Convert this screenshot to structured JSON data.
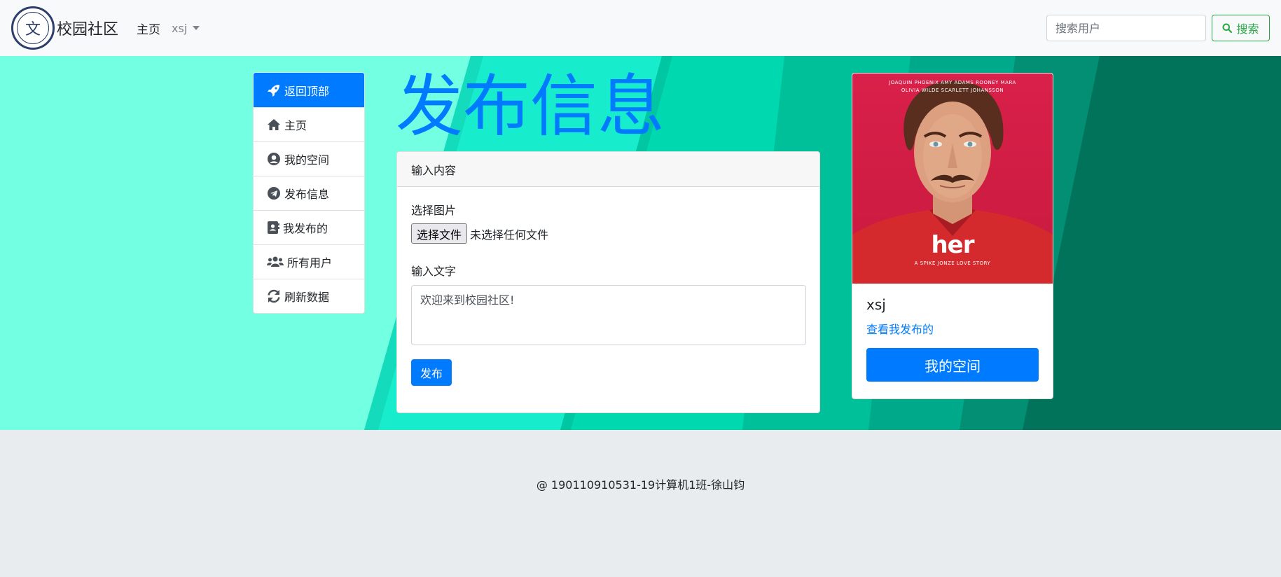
{
  "navbar": {
    "brand": "校园社区",
    "home_link": "主页",
    "user_dropdown": "xsj",
    "search_placeholder": "搜索用户",
    "search_button": "搜索"
  },
  "sidebar": {
    "items": [
      {
        "label": "返回顶部",
        "icon": "rocket-icon",
        "active": true
      },
      {
        "label": "主页",
        "icon": "home-icon",
        "active": false
      },
      {
        "label": "我的空间",
        "icon": "user-circle-icon",
        "active": false
      },
      {
        "label": "发布信息",
        "icon": "telegram-icon",
        "active": false
      },
      {
        "label": "我发布的",
        "icon": "address-book-icon",
        "active": false
      },
      {
        "label": "所有用户",
        "icon": "users-icon",
        "active": false
      },
      {
        "label": "刷新数据",
        "icon": "refresh-icon",
        "active": false
      }
    ]
  },
  "main": {
    "title": "发布信息",
    "card_header": "输入内容",
    "image_label": "选择图片",
    "file_button": "选择文件",
    "file_status": "未选择任何文件",
    "text_label": "输入文字",
    "text_value": "欢迎来到校园社区!",
    "publish_button": "发布"
  },
  "profile": {
    "poster_credits_line1": "JOAQUIN PHOENIX     AMY ADAMS     ROONEY MARA",
    "poster_credits_line2": "OLIVIA WILDE     SCARLETT JOHANSSON",
    "poster_title": "her",
    "poster_subtitle": "A SPIKE JONZE LOVE STORY",
    "name": "xsj",
    "link": "查看我发布的",
    "button": "我的空间"
  },
  "footer": {
    "text": "@ 190110910531-19计算机1班-徐山钧"
  },
  "colors": {
    "primary": "#007bff",
    "success": "#28a745",
    "hero_light": "#73ffe2",
    "hero_dark": "#00735a"
  }
}
